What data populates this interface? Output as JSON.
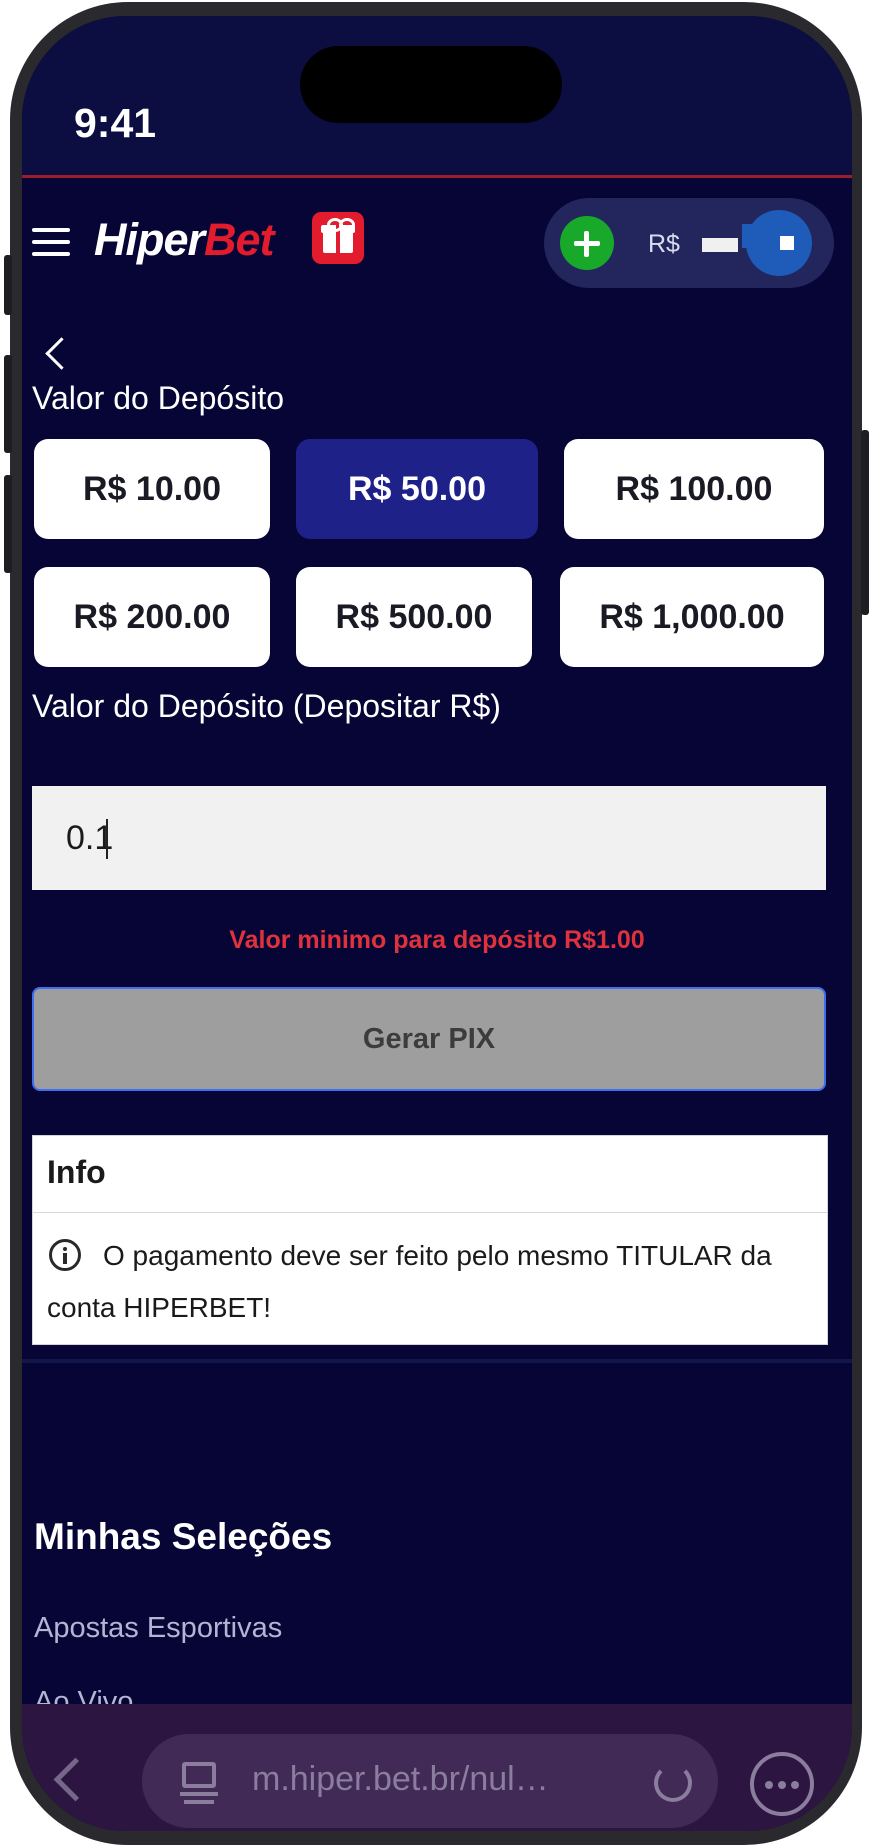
{
  "status_bar": {
    "time": "9:41"
  },
  "header": {
    "logo_part1": "Hiper",
    "logo_part2": "Bet",
    "balance_currency": "R$",
    "icons": [
      "menu-icon",
      "gift-icon",
      "add-icon",
      "avatar"
    ]
  },
  "deposit": {
    "label": "Valor do Depósito",
    "amounts": [
      "R$ 10.00",
      "R$ 50.00",
      "R$ 100.00",
      "R$ 200.00",
      "R$ 500.00",
      "R$ 1,000.00"
    ],
    "selected_amount": "R$ 50.00",
    "input_label": "Valor do Depósito (Depositar R$)",
    "input_value": "0.1",
    "error": "Valor minimo para depósito R$1.00",
    "submit_label": "Gerar PIX"
  },
  "info": {
    "title": "Info",
    "text": "O pagamento deve ser feito pelo mesmo TITULAR da conta HIPERBET!"
  },
  "selections": {
    "title": "Minhas Seleções",
    "items": [
      "Apostas Esportivas",
      "Ao Vivo"
    ]
  },
  "browser": {
    "url": "m.hiper.bet.br/nul…"
  },
  "colors": {
    "background": "#060535",
    "accent_red": "#e21b2d",
    "selected_button": "#1d2188",
    "add_green": "#18a82a",
    "error_text": "#e0323c"
  }
}
